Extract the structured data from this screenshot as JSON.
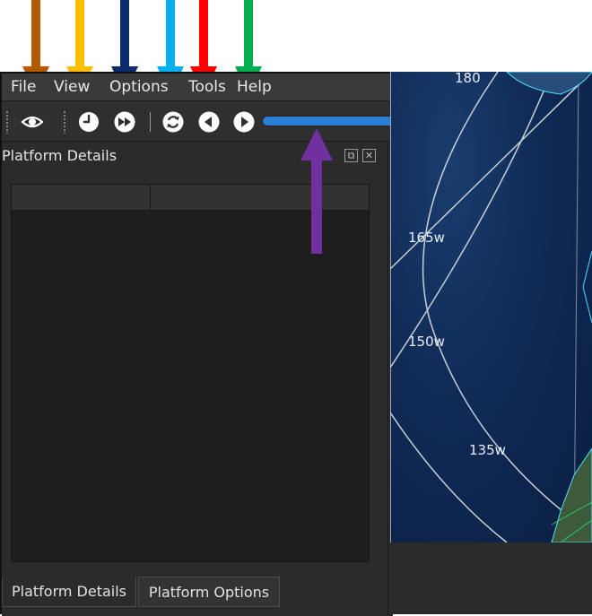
{
  "callout_colors": {
    "orange": "#b35a00",
    "yellow": "#ffbf00",
    "navy": "#0a2a6b",
    "sky": "#00b0f0",
    "red": "#ff0000",
    "green": "#00b050",
    "purple": "#7030a0"
  },
  "menu": {
    "file": "File",
    "view": "View",
    "options": "Options",
    "tools": "Tools",
    "help": "Help"
  },
  "toolbar": {
    "icons": [
      "eye-icon",
      "clock-icon",
      "fast-forward-icon",
      "loop-icon",
      "step-back-icon",
      "play-icon"
    ],
    "slider_value_fraction": 0.97
  },
  "dock": {
    "title": "Platform Details",
    "restore_glyph": "⧉",
    "close_glyph": "✕",
    "tabs": [
      "Platform Details",
      "Platform Options"
    ]
  },
  "map": {
    "labels": [
      "180",
      "165w",
      "150w",
      "135w"
    ],
    "land_color": "#3d5a3a",
    "ocean_color": "#0f2a55",
    "coast_color": "#4fe0ff",
    "grid_color": "#c9cfd8"
  }
}
